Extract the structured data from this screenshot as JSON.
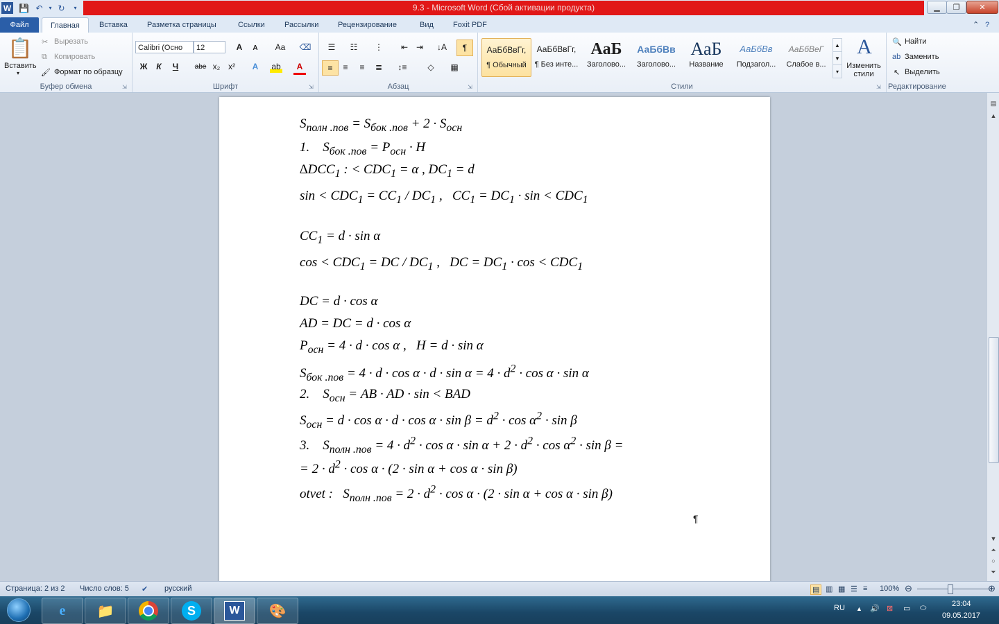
{
  "window": {
    "title": "9.3 - Microsoft Word (Сбой активации продукта)"
  },
  "tabs": [
    {
      "label": "Файл"
    },
    {
      "label": "Главная"
    },
    {
      "label": "Вставка"
    },
    {
      "label": "Разметка страницы"
    },
    {
      "label": "Ссылки"
    },
    {
      "label": "Рассылки"
    },
    {
      "label": "Рецензирование"
    },
    {
      "label": "Вид"
    },
    {
      "label": "Foxit PDF"
    }
  ],
  "clipboard": {
    "paste": "Вставить",
    "cut": "Вырезать",
    "copy": "Копировать",
    "format_painter": "Формат по образцу",
    "label": "Буфер обмена"
  },
  "font": {
    "family": "Calibri (Осно",
    "size": "12",
    "label": "Шрифт",
    "bold": "Ж",
    "italic": "К",
    "underline": "Ч",
    "strike": "abe",
    "sub": "x₂",
    "sup": "x²",
    "grow": "A",
    "shrink": "A",
    "case": "Aa"
  },
  "paragraph": {
    "label": "Абзац"
  },
  "styles": {
    "label": "Стили",
    "items": [
      {
        "preview": "АаБбВвГг,",
        "name": "¶ Обычный"
      },
      {
        "preview": "АаБбВвГг,",
        "name": "¶ Без инте..."
      },
      {
        "preview": "АаБ",
        "name": "Заголово..."
      },
      {
        "preview": "АаБбВв",
        "name": "Заголово..."
      },
      {
        "preview": "АаБ",
        "name": "Название"
      },
      {
        "preview": "АаБбВв",
        "name": "Подзагол..."
      },
      {
        "preview": "АаБбВеГ",
        "name": "Слабое в..."
      }
    ],
    "change": "Изменить стили"
  },
  "editing": {
    "find": "Найти",
    "replace": "Заменить",
    "select": "Выделить",
    "label": "Редактирование"
  },
  "document": {
    "lines": [
      "S<sub>полн .пов</sub> = S<sub>бок .пов</sub> + 2 · S<sub>осн</sub>",
      "1.&nbsp;&nbsp;&nbsp; S<sub>бок .пов</sub> = P<sub>осн</sub> · H",
      "∆DCC<sub>1</sub> : &lt; CDC<sub>1</sub> = α , DC<sub>1</sub> = d",
      "sin &lt; CDC<sub>1</sub> = CC<sub>1</sub> / DC<sub>1</sub> ,&nbsp;&nbsp; CC<sub>1</sub> = DC<sub>1</sub> · sin &lt; CDC<sub>1</sub>",
      "CC<sub>1</sub> = d · sin α",
      "cos &lt; CDC<sub>1</sub> = DC / DC<sub>1</sub> ,&nbsp;&nbsp; DC = DC<sub>1</sub> · cos &lt; CDC<sub>1</sub>",
      "DC = d · cos α",
      "AD = DC = d · cos α",
      "P<sub>осн</sub> = 4 · d · cos α ,&nbsp;&nbsp; H = d · sin α",
      "S<sub>бок .пов</sub> = 4 · d · cos α · d · sin α = 4 · d<sup>2</sup> · cos α · sin α",
      "2.&nbsp;&nbsp;&nbsp; S<sub>осн</sub> = AB · AD · sin &lt; BAD",
      "S<sub>осн</sub> = d · cos α · d · cos α · sin β = d<sup>2</sup> · cos α<sup>2</sup> · sin β",
      "3.&nbsp;&nbsp;&nbsp; S<sub>полн .пов</sub> = 4 · d<sup>2</sup> · cos α · sin α + 2 · d<sup>2</sup> · cos α<sup>2</sup> · sin β =",
      "= 2 · d<sup>2</sup> · cos α · (2 · sin α + cos α · sin β)",
      "otvet :&nbsp;&nbsp; S<sub>полн .пов</sub> = 2 · d<sup>2</sup> · cos α · (2 · sin α + cos α · sin β)"
    ],
    "pilcrow": "¶"
  },
  "status": {
    "page": "Страница: 2 из 2",
    "words": "Число слов: 5",
    "lang": "русский",
    "zoom": "100%"
  },
  "taskbar": {
    "lang": "RU",
    "time": "23:04",
    "date": "09.05.2017"
  }
}
